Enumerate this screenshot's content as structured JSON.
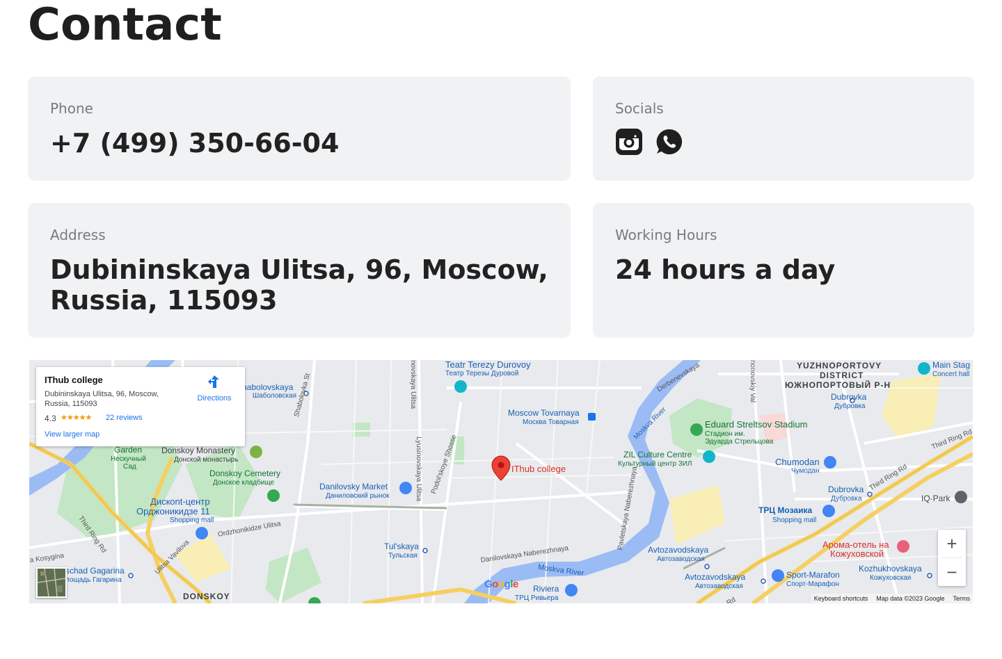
{
  "page": {
    "title": "Contact"
  },
  "phone": {
    "label": "Phone",
    "value": "+7 (499) 350-66-04"
  },
  "socials": {
    "label": "Socials",
    "icons": [
      "instagram-icon",
      "whatsapp-icon"
    ]
  },
  "address": {
    "label": "Address",
    "value": "Dubininskaya Ulitsa, 96, Moscow, Russia, 115093"
  },
  "hours": {
    "label": "Working Hours",
    "value": "24 hours a day"
  },
  "map": {
    "infobox": {
      "title": "IThub college",
      "address": "Dubininskaya Ulitsa, 96, Moscow, Russia, 115093",
      "rating": "4.3",
      "stars": "★★★★★",
      "reviews": "22 reviews",
      "directions": "Directions",
      "larger_map": "View larger map"
    },
    "marker_label": "IThub college",
    "labels": {
      "teatr_en": "Teatr Terezy Durovoy",
      "teatr_ru": "Театр Терезы Дуровой",
      "shabolovskaya_en": "habolovskaya",
      "shabolovskaya_ru": "Шаболовская",
      "shabolovka_st": "Shabolovka St",
      "lyusinovskaya": "Lyusinovskaya Ulitsa",
      "novskaya": "novskaya Ulitsa",
      "podolskoye": "Podol'skoye Shosse",
      "derbenevskaya": "Derbenevskaya",
      "nonovsky_val": "nonovskiy Val",
      "moskva_river_1": "Moskva River",
      "moskva_river_2": "Moskva River",
      "moscow_tovarnaya_en": "Moscow Tovarnaya",
      "moscow_tovarnaya_ru": "Москва Товарная",
      "yuzhno_en_1": "YUZHNOPORTOVY",
      "yuzhno_en_2": "DISTRICT",
      "yuzhno_ru": "ЮЖНОПОРТОВЫЙ Р-Н",
      "main_stage": "Main Stag",
      "concert_hall": "Concert hall",
      "dubrovka_1_en": "Dubrovka",
      "dubrovka_1_ru": "Дубровка",
      "streltsov_en": "Eduard Streltsov Stadium",
      "streltsov_ru_1": "Стадион им.",
      "streltsov_ru_2": "Эдуарда Стрельцова",
      "third_ring_1": "Third Ring Rd",
      "third_ring_2": "Third Ring Rd",
      "third_ring_3": "Third Ring Rd",
      "garden_en": "Garden",
      "garden_ru_1": "Нескучный",
      "garden_ru_2": "Сад",
      "donskoy_mon_en": "Donskoy Monastery",
      "donskoy_mon_ru": "Донской монастырь",
      "zil_en": "ZIL Culture Centre",
      "zil_ru": "Культурный центр ЗИЛ",
      "chumodan_en": "Chumodan",
      "chumodan_ru": "Чумодан",
      "donskoy_cem_en": "Donskoy Cemetery",
      "donskoy_cem_ru": "Донское кладбище",
      "danilovsky_en": "Danilovsky Market",
      "danilovsky_ru": "Даниловский рынок",
      "dubrovka_2_en": "Dubrovka",
      "dubrovka_2_ru": "Дубровка",
      "iq_park": "IQ-Park",
      "disk_center_1": "Дискont-центр",
      "disk_center_2": "Орджоникидзе 11",
      "disk_center_3": "Shopping mall",
      "tc_mozaika": "ТРЦ Мозаика",
      "tc_mozaika_sub": "Shopping mall",
      "ordzhonikidze": "Ordzhonikidze Ulitsa",
      "naberezhnaya": "Pavletskaya Naberezhnaya",
      "avtozavodskaya_1_en": "Avtozavodskaya",
      "avtozavodskaya_1_ru": "Автозаводская",
      "aroma_1": "Арома-отель на",
      "aroma_2": "Кожуховской",
      "tulskaya_en": "Tul'skaya",
      "tulskaya_ru": "Тульская",
      "danilovskaya_nab": "Danilovskaya Naberezhnaya",
      "ulitsa_vavilova": "Ulitsa Vavilova",
      "kosygina": "a Kosygina",
      "gagarina_en": "schad Gagarina",
      "gagarina_ru": "лощадь Гагарина",
      "kozhukhovskaya_en": "Kozhukhovskaya",
      "kozhukhovskaya_ru": "Кожуховская",
      "sport_marafon_en": "Sport-Marafon",
      "sport_marafon_ru": "Спорт-Марафон",
      "avtozavodskaya_2_en": "Avtozavodskaya",
      "avtozavodskaya_2_ru": "Автозаводская",
      "riviera_en": "Riviera",
      "riviera_ru": "ТРЦ Ривьера",
      "donskoy_district": "DONSKOY",
      "rd": "Rd"
    },
    "google_logo": "Google",
    "zoom_in": "+",
    "zoom_out": "−",
    "attribution": {
      "shortcuts": "Keyboard shortcuts",
      "data": "Map data ©2023 Google",
      "terms": "Terms"
    },
    "colors": {
      "water": "#9bbbf5",
      "park": "#c3e6c4",
      "highway": "#f5d061",
      "road": "#ffffff",
      "marker": "#ea4335",
      "land": "#e8eaed"
    }
  }
}
